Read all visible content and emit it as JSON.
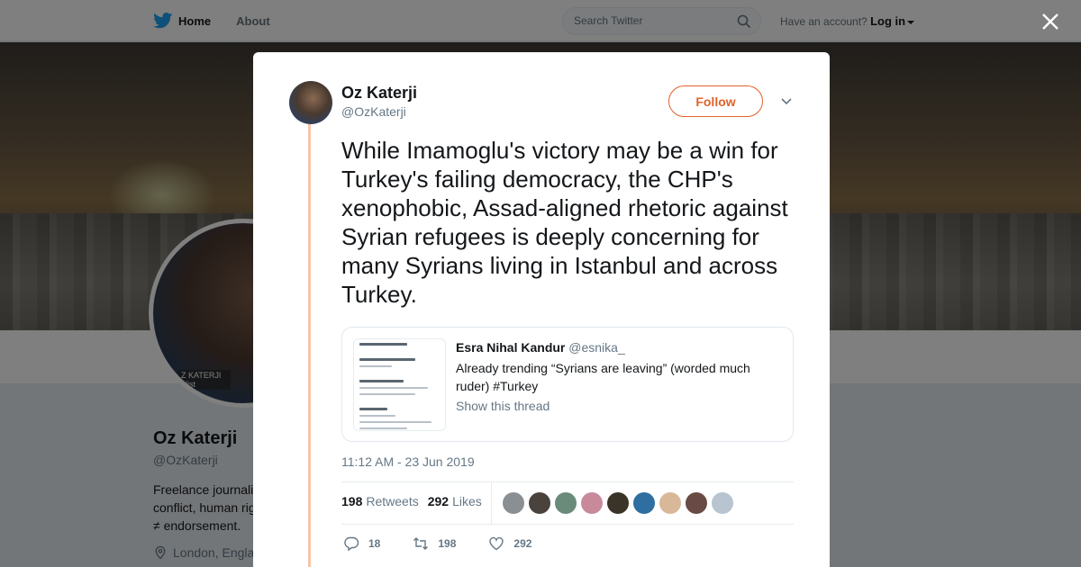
{
  "nav": {
    "home_label": "Home",
    "about_label": "About",
    "search_placeholder": "Search Twitter",
    "account_prompt": "Have an account?",
    "login_label": "Log in"
  },
  "profile": {
    "name": "Oz Katerji",
    "handle": "@OzKaterji",
    "bio_lines": [
      "Freelance journali",
      "conflict, human rig",
      "≠ endorsement."
    ],
    "location": "London, Engla",
    "avatar_caption_1": "Z KATERJI",
    "avatar_caption_2": "alist"
  },
  "tweet": {
    "author_name": "Oz Katerji",
    "author_handle": "@OzKaterji",
    "follow_label": "Follow",
    "text": "While Imamoglu's victory may be a win for Turkey's failing democracy, the CHP's xenophobic, Assad-aligned rhetoric against Syrian refugees is deeply concerning for many Syrians living in Istanbul and across Turkey.",
    "timestamp": "11:12 AM - 23 Jun 2019",
    "retweets_count": "198",
    "retweets_label": "Retweets",
    "likes_count": "292",
    "likes_label": "Likes",
    "reply_count": "18",
    "retweet_action_count": "198",
    "like_action_count": "292"
  },
  "quote": {
    "name": "Esra Nihal Kandur",
    "handle": "@esnika_",
    "text": "Already trending “Syrians are leaving” (worded much ruder) #Turkey",
    "show_thread_label": "Show this thread"
  },
  "likers": [
    {
      "color": "#8a8f94"
    },
    {
      "color": "#4a423c"
    },
    {
      "color": "#6a8a7a"
    },
    {
      "color": "#c88a9a"
    },
    {
      "color": "#3a3428"
    },
    {
      "color": "#2e6ea0"
    },
    {
      "color": "#d8b898"
    },
    {
      "color": "#6a4a44"
    },
    {
      "color": "#b8c4d0"
    }
  ],
  "colors": {
    "accent": "#e0622a",
    "thread_line": "#f8c5a8",
    "twitter_blue": "#1da1f2"
  }
}
